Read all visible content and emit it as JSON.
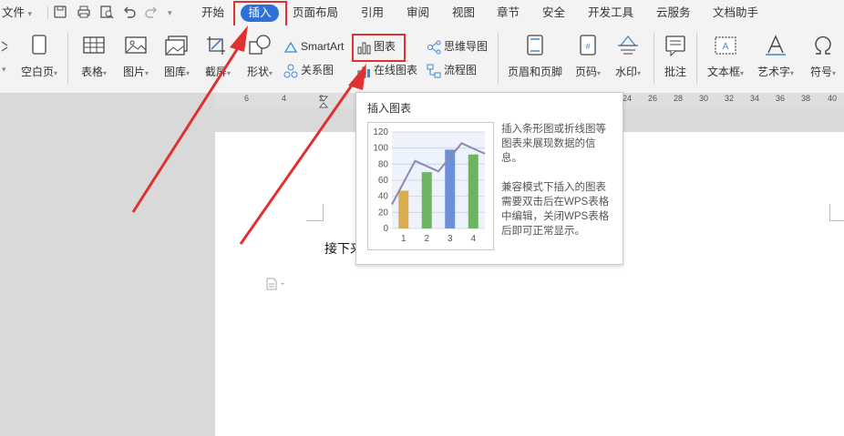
{
  "menubar": {
    "file": "文件",
    "tabs": [
      "开始",
      "插入",
      "页面布局",
      "引用",
      "审阅",
      "视图",
      "章节",
      "安全",
      "开发工具",
      "云服务",
      "文档助手"
    ],
    "active_tab": "插入"
  },
  "ribbon": {
    "blank_page": "空白页",
    "table": "表格",
    "picture": "图片",
    "gallery": "图库",
    "screenshot": "截屏",
    "shape": "形状",
    "smartart": "SmartArt",
    "relation": "关系图",
    "chart": "图表",
    "online_chart": "在线图表",
    "mindmap": "思维导图",
    "flowchart": "流程图",
    "header_footer": "页眉和页脚",
    "page_number": "页码",
    "watermark": "水印",
    "comment": "批注",
    "textbox": "文本框",
    "wordart": "艺术字",
    "symbol": "符号"
  },
  "ruler": {
    "left_numbers": [
      "6",
      "4",
      "2"
    ],
    "right_numbers": [
      "24",
      "26",
      "28",
      "30",
      "32",
      "34",
      "36",
      "38",
      "40"
    ]
  },
  "document": {
    "text": "接下来"
  },
  "tooltip": {
    "title": "插入图表",
    "desc1": "插入条形图或折线图等图表来展现数据的信息。",
    "desc2": "兼容模式下插入的图表需要双击后在WPS表格中编辑，关闭WPS表格后即可正常显示。"
  },
  "chart_data": {
    "type": "bar",
    "categories": [
      "1",
      "2",
      "3",
      "4"
    ],
    "values": [
      47,
      70,
      98,
      92
    ],
    "line": [
      30,
      84,
      71,
      106,
      93
    ],
    "bar_colors": [
      "#d9ac4e",
      "#6db462",
      "#6d8fd8",
      "#6db462"
    ],
    "line_color": "#8a8aae",
    "y_ticks": [
      "0",
      "20",
      "40",
      "60",
      "80",
      "100",
      "120"
    ],
    "ylim": [
      0,
      120
    ]
  },
  "colors": {
    "accent": "#2e6fd9",
    "annotation": "#e03030"
  }
}
